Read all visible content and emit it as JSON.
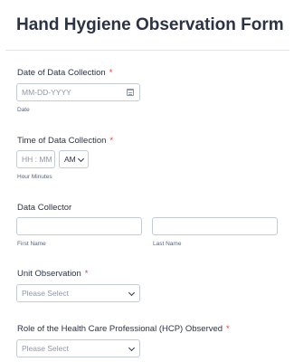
{
  "form": {
    "title": "Hand Hygiene Observation Form"
  },
  "fields": {
    "date": {
      "label": "Date of Data Collection",
      "required": "*",
      "placeholder": "MM-DD-YYYY",
      "sublabel": "Date"
    },
    "time": {
      "label": "Time of Data Collection",
      "required": "*",
      "placeholder": "HH : MM",
      "ampm": "AM",
      "sublabel": "Hour Minutes"
    },
    "collector": {
      "label": "Data Collector",
      "first_sublabel": "First Name",
      "last_sublabel": "Last Name"
    },
    "unit": {
      "label": "Unit Observation",
      "required": "*",
      "placeholder": "Please Select"
    },
    "role": {
      "label": "Role of the Health Care Professional (HCP) Observed",
      "required": "*",
      "placeholder": "Please Select"
    }
  },
  "icons": {
    "calendar": "calendar-icon",
    "dropdown": "chevron-down-icon"
  },
  "colors": {
    "required": "#f23a3c",
    "text": "#2c3345",
    "border": "#c3cad8"
  }
}
